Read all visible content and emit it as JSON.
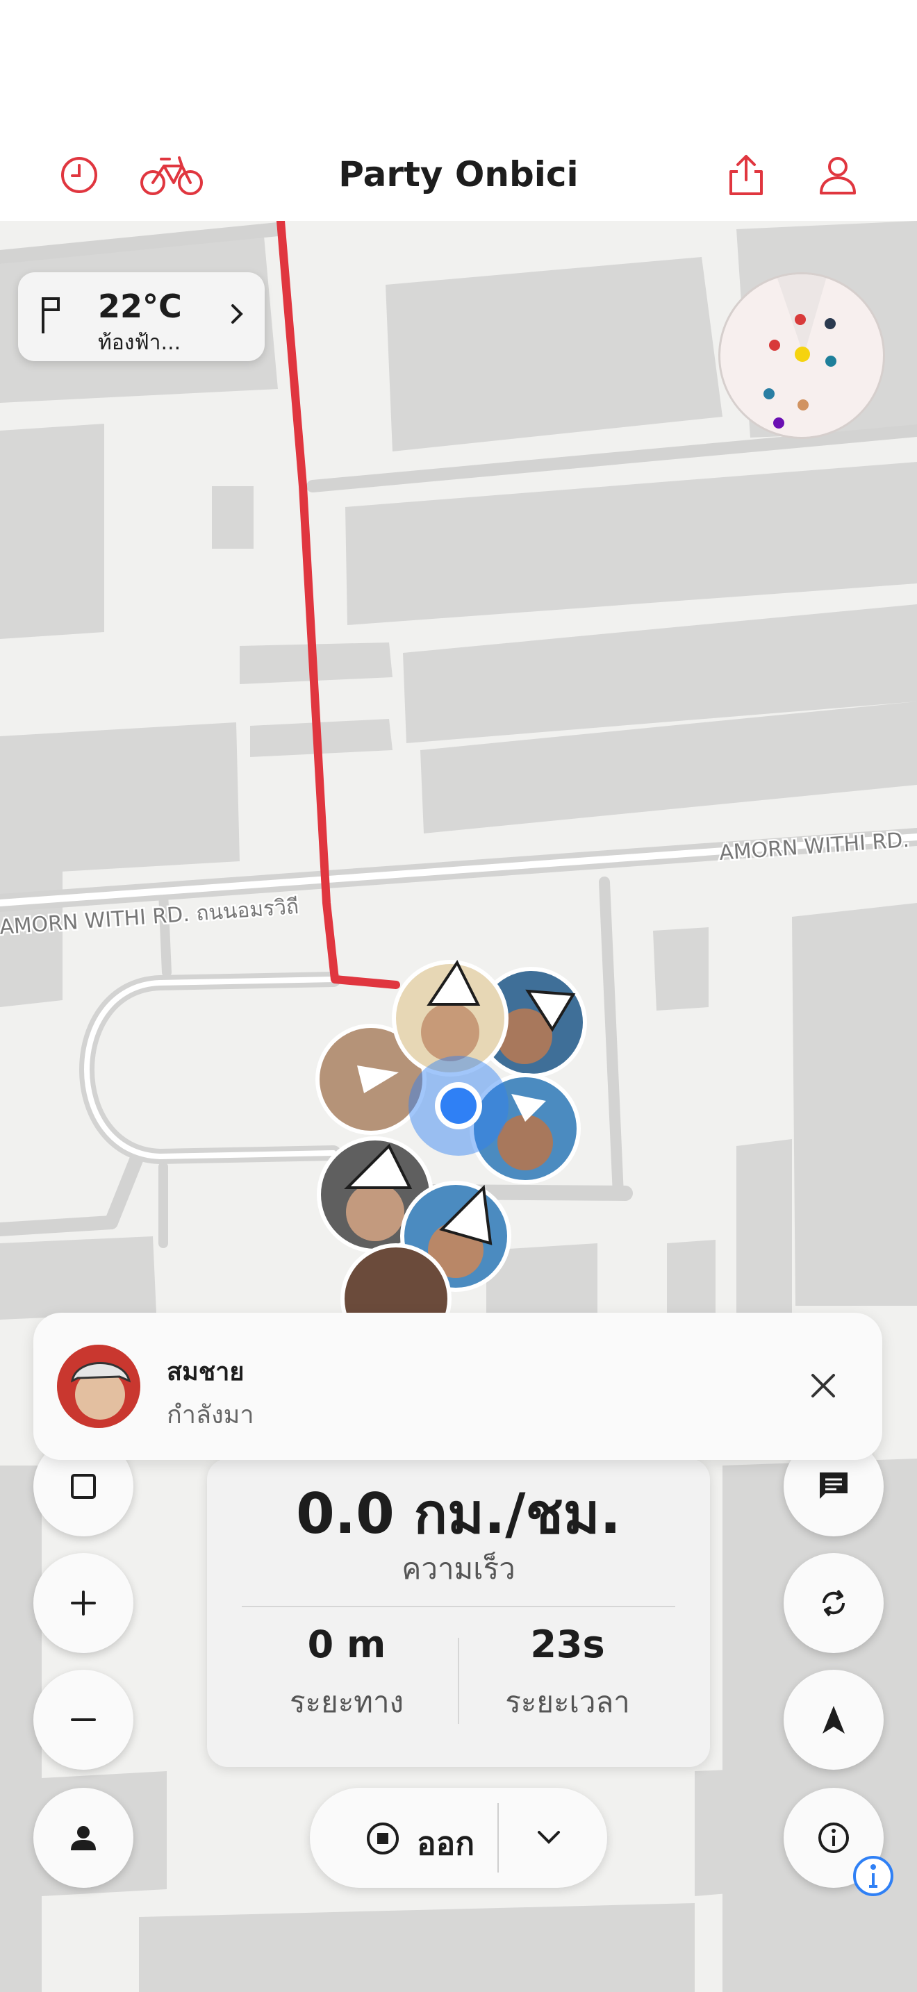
{
  "header": {
    "title": "Party Onbici",
    "icons": [
      "history-icon",
      "bicycle-icon",
      "share-icon",
      "profile-icon"
    ]
  },
  "colors": {
    "accent": "#e0363f",
    "location_blue": "#2f80f5",
    "route": "#e0363f"
  },
  "map": {
    "street_labels": [
      "AMORN WITHI RD.",
      "AMORN WITHI RD. ถนนอมรวิถี"
    ]
  },
  "weather": {
    "temperature": "22°C",
    "condition": "ท้องฟ้า..."
  },
  "notification": {
    "name": "สมชาย",
    "status": "กำลังมา"
  },
  "stats": {
    "speed": "0.0 กม./ชม.",
    "speed_label": "ความเร็ว",
    "distance": "0 m",
    "distance_label": "ระยะทาง",
    "duration": "23s",
    "duration_label": "ระยะเวลา"
  },
  "end_button": {
    "label": "ออก"
  },
  "map_controls": {
    "left": [
      "stop-square-icon",
      "zoom-in-icon",
      "zoom-out-icon",
      "person-icon"
    ],
    "right": [
      "chat-icon",
      "refresh-icon",
      "navigate-arrow-icon",
      "info-icon"
    ]
  }
}
